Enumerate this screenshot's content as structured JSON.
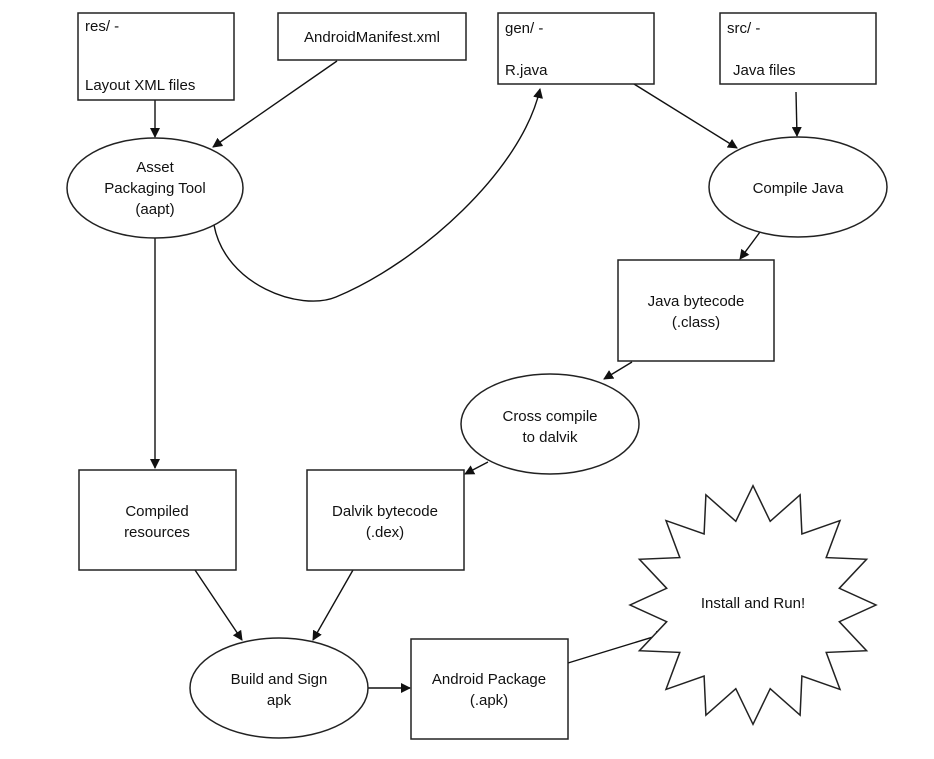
{
  "nodes": {
    "res": {
      "line1": "res/ -",
      "line2": "Layout XML files"
    },
    "manifest": {
      "label": "AndroidManifest.xml"
    },
    "gen": {
      "line1": "gen/ -",
      "line2": "R.java"
    },
    "src": {
      "line1": "src/ -",
      "line2": "Java files"
    },
    "aapt": {
      "line1": "Asset",
      "line2": "Packaging Tool",
      "line3": "(aapt)"
    },
    "compile_java": {
      "label": "Compile Java"
    },
    "java_bytecode": {
      "line1": "Java bytecode",
      "line2": "(.class)"
    },
    "cross_compile": {
      "line1": "Cross compile",
      "line2": "to dalvik"
    },
    "compiled_resources": {
      "line1": "Compiled",
      "line2": "resources"
    },
    "dalvik_bytecode": {
      "line1": "Dalvik bytecode",
      "line2": "(.dex)"
    },
    "build_sign": {
      "line1": "Build and Sign",
      "line2": "apk"
    },
    "android_package": {
      "line1": "Android Package",
      "line2": "(.apk)"
    },
    "install_run": {
      "label": "Install and Run!"
    }
  },
  "edges": [
    {
      "from": "res",
      "to": "aapt"
    },
    {
      "from": "manifest",
      "to": "aapt"
    },
    {
      "from": "aapt",
      "to": "gen"
    },
    {
      "from": "gen",
      "to": "compile_java"
    },
    {
      "from": "src",
      "to": "compile_java"
    },
    {
      "from": "compile_java",
      "to": "java_bytecode"
    },
    {
      "from": "java_bytecode",
      "to": "cross_compile"
    },
    {
      "from": "aapt",
      "to": "compiled_resources"
    },
    {
      "from": "cross_compile",
      "to": "dalvik_bytecode"
    },
    {
      "from": "compiled_resources",
      "to": "build_sign"
    },
    {
      "from": "dalvik_bytecode",
      "to": "build_sign"
    },
    {
      "from": "build_sign",
      "to": "android_package"
    },
    {
      "from": "android_package",
      "to": "install_run"
    }
  ]
}
